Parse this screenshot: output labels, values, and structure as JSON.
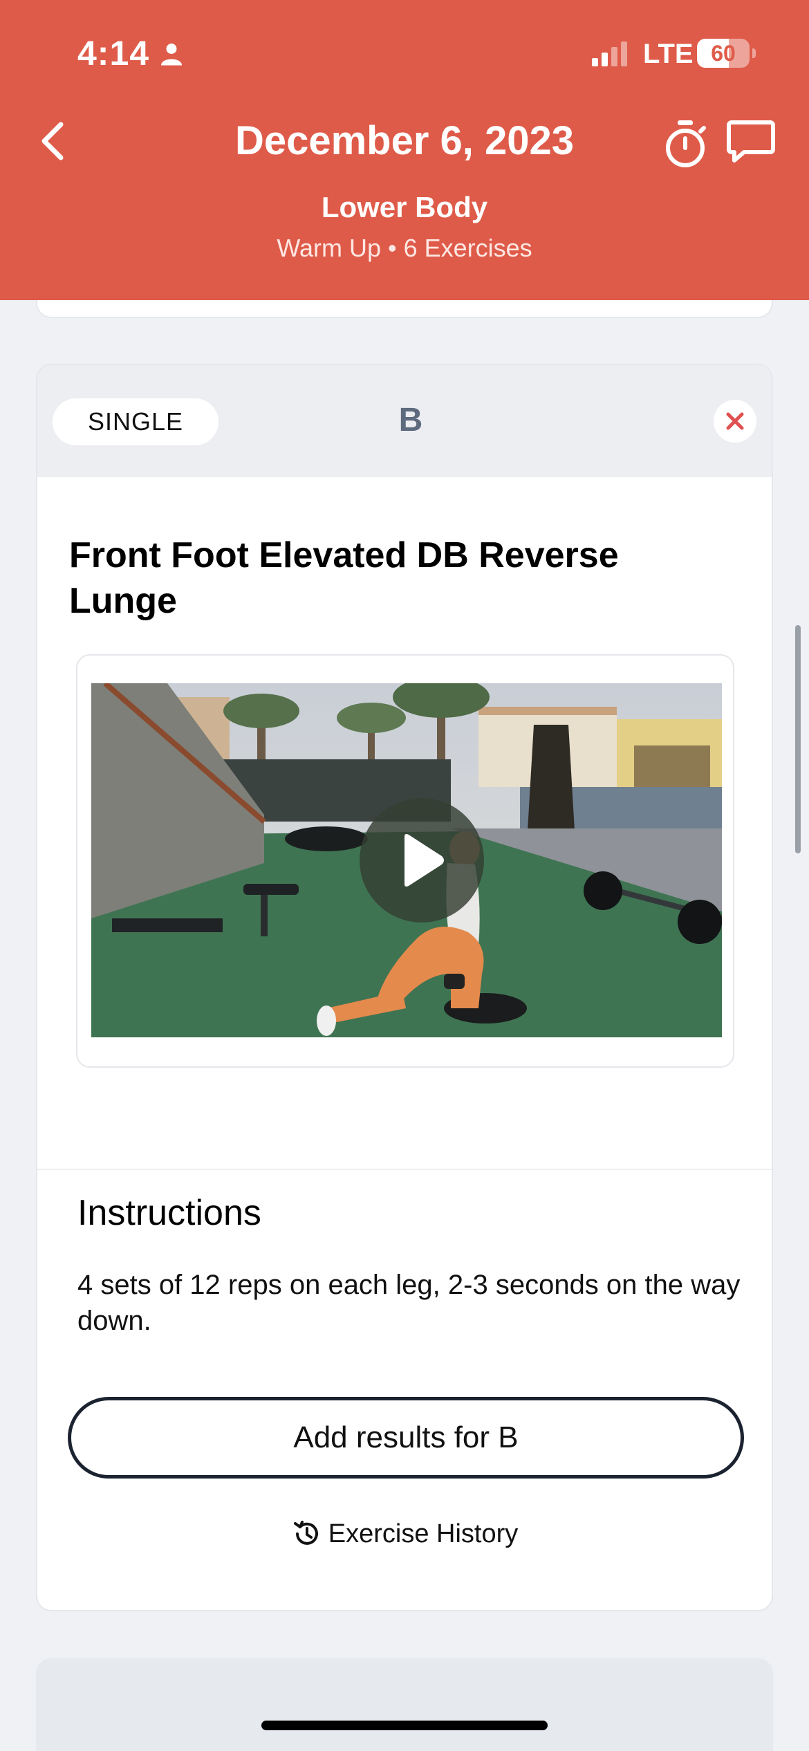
{
  "status_bar": {
    "time": "4:14",
    "network": "LTE",
    "battery_level": "60",
    "battery_fraction": 0.6
  },
  "header": {
    "date_title": "December 6, 2023",
    "workout_name": "Lower Body",
    "workout_subtitle": "Warm Up • 6 Exercises",
    "background_color": "#df5b49",
    "icons": [
      "chevron-left-icon",
      "stopwatch-icon",
      "chat-bubble-icon"
    ]
  },
  "exercise": {
    "type": "SINGLE",
    "group_letter": "B",
    "title": "Front Foot Elevated DB Reverse Lunge",
    "instructions_heading": "Instructions",
    "instructions_text": "4 sets of 12 reps on each leg, 2-3 seconds on the way down.",
    "add_results_label": "Add results for B",
    "history_label": "Exercise History",
    "remove_color": "#e05050"
  }
}
